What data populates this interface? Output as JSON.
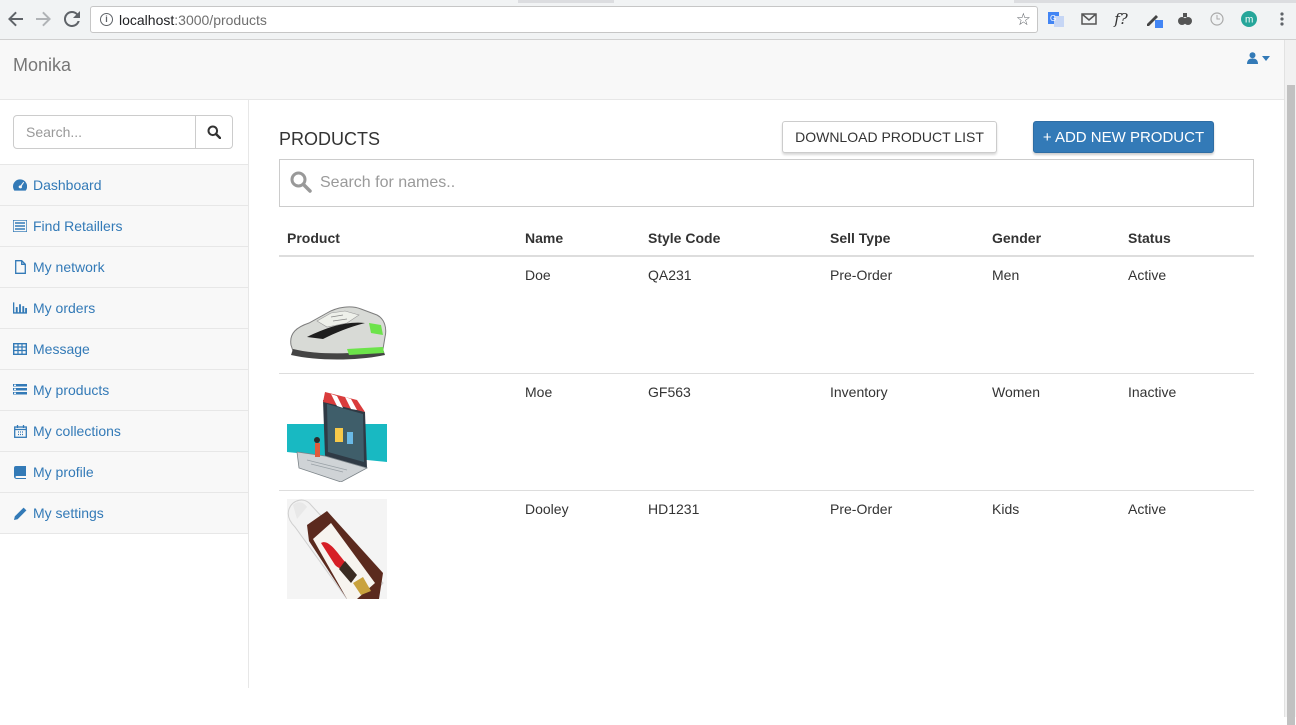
{
  "browser": {
    "url_host": "localhost",
    "url_path": ":3000/products"
  },
  "app": {
    "brand": "Monika"
  },
  "sidebar": {
    "search_placeholder": "Search...",
    "items": [
      {
        "label": "Dashboard",
        "icon": "dashboard-icon"
      },
      {
        "label": "Find Retaillers",
        "icon": "list-icon"
      },
      {
        "label": "My network",
        "icon": "file-icon"
      },
      {
        "label": "My orders",
        "icon": "bar-chart-icon"
      },
      {
        "label": "Message",
        "icon": "table-icon"
      },
      {
        "label": "My products",
        "icon": "list-alt-icon"
      },
      {
        "label": "My collections",
        "icon": "calendar-icon"
      },
      {
        "label": "My profile",
        "icon": "book-icon"
      },
      {
        "label": "My settings",
        "icon": "pencil-icon"
      }
    ]
  },
  "main": {
    "title": "PRODUCTS",
    "download_label": "DOWNLOAD PRODUCT LIST",
    "add_label": "+ ADD NEW PRODUCT",
    "search_placeholder": "Search for names..",
    "columns": [
      "Product",
      "Name",
      "Style Code",
      "Sell Type",
      "Gender",
      "Status"
    ],
    "rows": [
      {
        "image": "sneaker-image",
        "name": "Doe",
        "style_code": "QA231",
        "sell_type": "Pre-Order",
        "gender": "Men",
        "status": "Active"
      },
      {
        "image": "laptop-shop-image",
        "name": "Moe",
        "style_code": "GF563",
        "sell_type": "Inventory",
        "gender": "Women",
        "status": "Inactive"
      },
      {
        "image": "nutella-spray-image",
        "name": "Dooley",
        "style_code": "HD1231",
        "sell_type": "Pre-Order",
        "gender": "Kids",
        "status": "Active"
      }
    ]
  },
  "colors": {
    "link": "#337ab7",
    "primary_button": "#337ab7"
  }
}
